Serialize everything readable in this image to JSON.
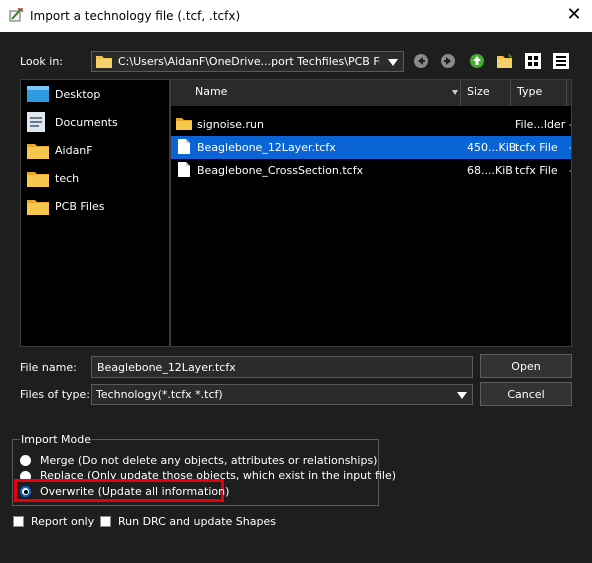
{
  "window": {
    "title": "Import a technology file (.tcf, .tcfx)"
  },
  "look_in": {
    "label": "Look in:",
    "path": "C:\\Users\\AidanF\\OneDrive...port Techfiles\\PCB Files"
  },
  "places": [
    {
      "label": "Desktop",
      "icon": "desktop-icon"
    },
    {
      "label": "Documents",
      "icon": "documents-icon"
    },
    {
      "label": "AidanF",
      "icon": "folder-icon"
    },
    {
      "label": "tech",
      "icon": "folder-icon"
    },
    {
      "label": "PCB Files",
      "icon": "folder-icon"
    }
  ],
  "columns": {
    "name": "Name",
    "size": "Size",
    "type": "Type"
  },
  "files": [
    {
      "name": "signoise.run",
      "size": "",
      "type": "File...lder",
      "more": "-",
      "icon": "folder-icon",
      "selected": false
    },
    {
      "name": "Beaglebone_12Layer.tcfx",
      "size": "450...KiB",
      "type": "tcfx File",
      "more": "-",
      "icon": "file-icon",
      "selected": true
    },
    {
      "name": "Beaglebone_CrossSection.tcfx",
      "size": "68....KiB",
      "type": "tcfx File",
      "more": "-",
      "icon": "file-icon",
      "selected": false
    }
  ],
  "file_name": {
    "label": "File name:",
    "value": "Beaglebone_12Layer.tcfx"
  },
  "files_of_type": {
    "label": "Files of type:",
    "value": "Technology(*.tcfx *.tcf)"
  },
  "buttons": {
    "open": "Open",
    "cancel": "Cancel"
  },
  "import_mode": {
    "title": "Import Mode",
    "options": [
      {
        "label": "Merge (Do not delete any objects, attributes or relationships)",
        "selected": false
      },
      {
        "label": "Replace (Only update those objects, which exist in the input file)",
        "selected": false
      },
      {
        "label": "Overwrite (Update all information)",
        "selected": true
      }
    ]
  },
  "checkboxes": [
    {
      "label": "Report only",
      "checked": false
    },
    {
      "label": "Run DRC and update Shapes",
      "checked": false
    }
  ],
  "colors": {
    "accent": "#0a64d6",
    "highlight": "#e8000e",
    "background": "#1e1e1e"
  }
}
